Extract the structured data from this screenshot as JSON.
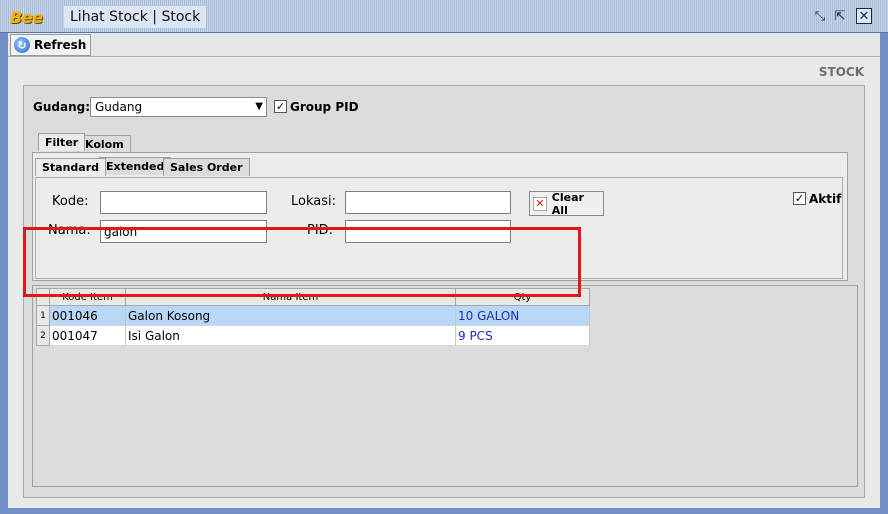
{
  "window": {
    "logo": "Bee",
    "title": "Lihat Stock | Stock",
    "controls": [
      "restore-icon",
      "maximize-icon",
      "close-icon"
    ]
  },
  "toolbar": {
    "refresh_label": "Refresh"
  },
  "page": {
    "section_label": "STOCK"
  },
  "form": {
    "gudang_label": "Gudang:",
    "gudang_value": "Gudang",
    "group_pid_label": "Group PID",
    "group_pid_checked": true
  },
  "tabs": {
    "top": [
      {
        "label": "Filter"
      },
      {
        "label": "Kolom"
      }
    ],
    "sub": [
      {
        "label": "Standard"
      },
      {
        "label": "Extended"
      },
      {
        "label": "Sales Order"
      }
    ]
  },
  "filter": {
    "kode_label": "Kode:",
    "kode_value": "",
    "nama_label": "Nama:",
    "nama_value": "galon",
    "lokasi_label": "Lokasi:",
    "lokasi_value": "",
    "pid_label": "PID:",
    "pid_value": "",
    "clear_all_label": "Clear All",
    "aktif_label": "Aktif",
    "aktif_checked": true
  },
  "grid": {
    "columns": [
      "Kode Item",
      "Nama Item",
      "Qty"
    ],
    "rows": [
      {
        "num": "1",
        "kode": "001046",
        "nama": "Galon Kosong",
        "qty": "10 GALON"
      },
      {
        "num": "2",
        "kode": "001047",
        "nama": "Isi Galon",
        "qty": "9 PCS"
      }
    ]
  },
  "colors": {
    "highlight": "#e01818",
    "selected_row": "#b9d7f7",
    "qty_text": "#1a2fb0"
  }
}
